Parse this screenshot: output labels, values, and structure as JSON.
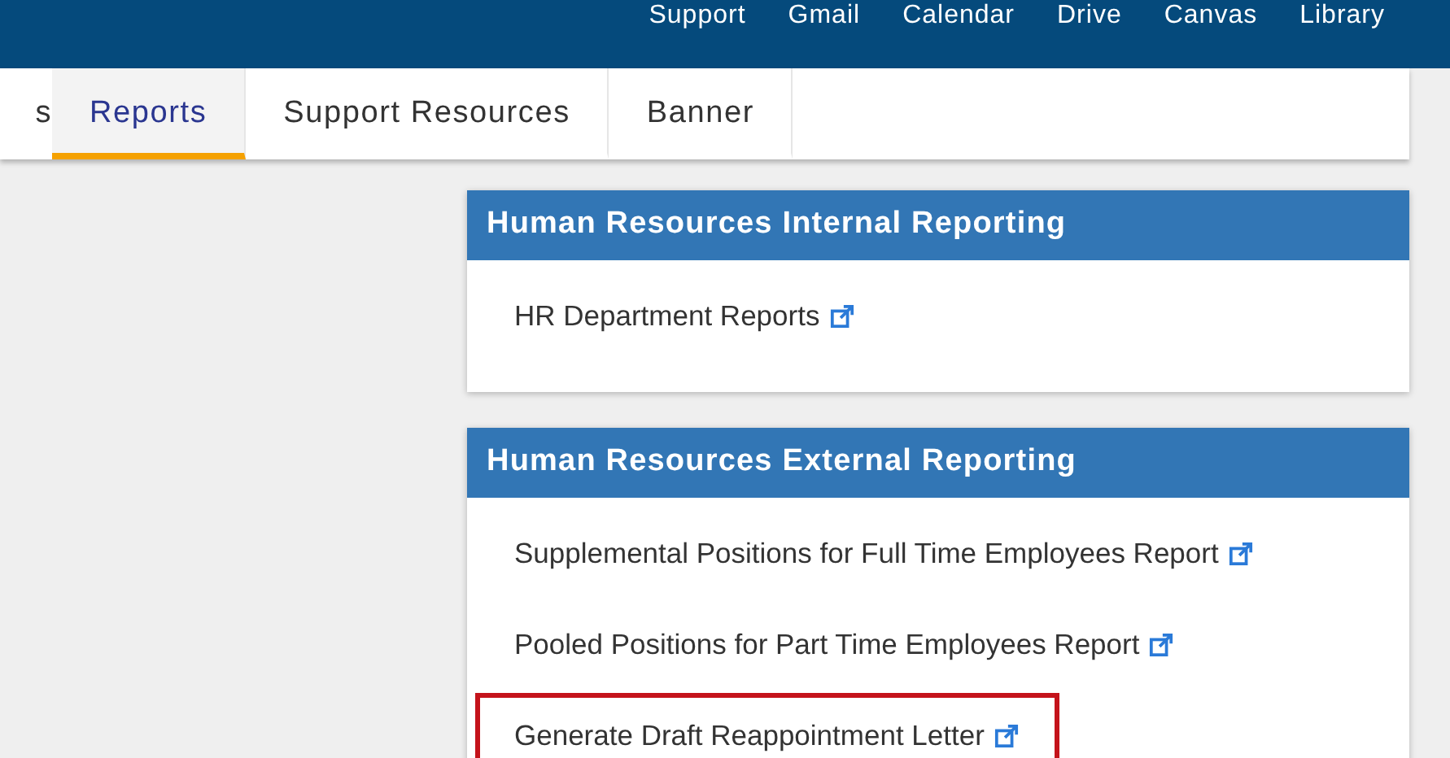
{
  "top_nav": [
    "Support",
    "Gmail",
    "Calendar",
    "Drive",
    "Canvas",
    "Library"
  ],
  "tabs": [
    {
      "label": "s",
      "selected": false
    },
    {
      "label": "Reports",
      "selected": true
    },
    {
      "label": "Support Resources",
      "selected": false
    },
    {
      "label": "Banner",
      "selected": false
    }
  ],
  "panels": [
    {
      "title": "Human Resources Internal Reporting",
      "links": [
        {
          "label": "HR Department Reports",
          "highlighted": false
        }
      ]
    },
    {
      "title": "Human Resources External Reporting",
      "links": [
        {
          "label": "Supplemental Positions for Full Time Employees Report",
          "highlighted": false
        },
        {
          "label": "Pooled Positions for Part Time Employees Report",
          "highlighted": false
        },
        {
          "label": "Generate Draft Reappointment Letter",
          "highlighted": true
        }
      ]
    }
  ]
}
